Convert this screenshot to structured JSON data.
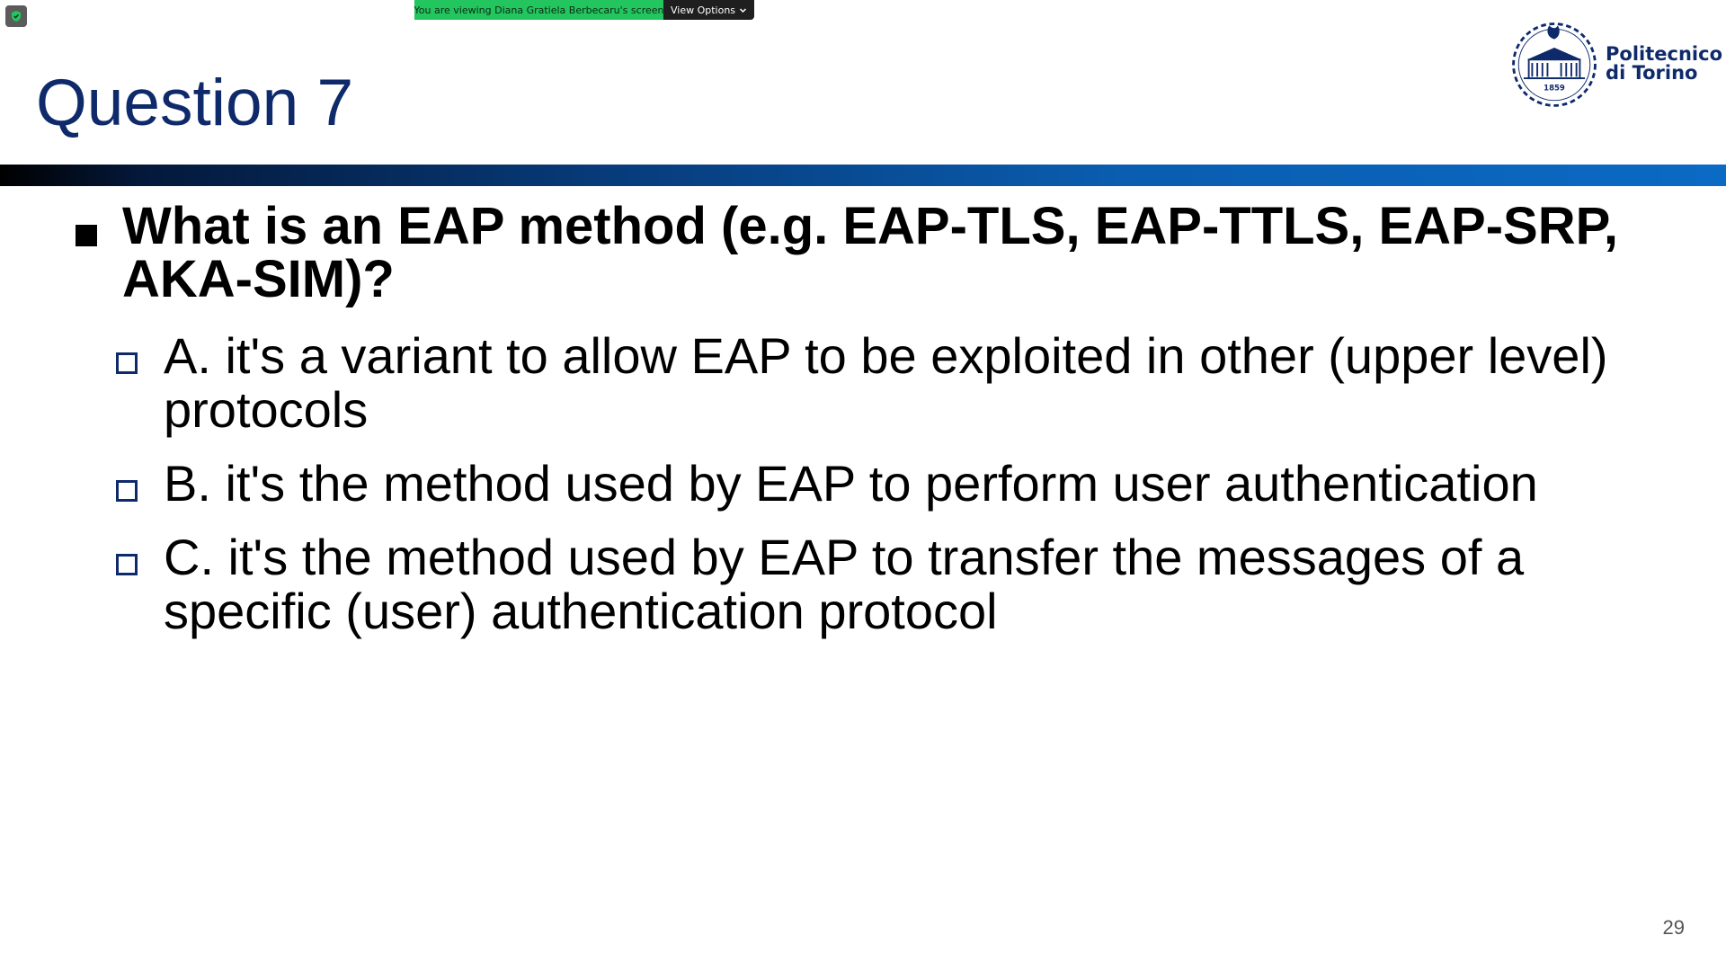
{
  "zoom": {
    "viewing_text": "You are viewing Diana Gratiela Berbecaru's screen",
    "view_options_label": "View Options",
    "shield_icon": "shield-icon",
    "chevron_icon": "chevron-down-icon"
  },
  "slide": {
    "title": "Question 7",
    "logo": {
      "line1": "Politecnico",
      "line2": "di Torino",
      "year": "1859"
    },
    "question": "What is an EAP method (e.g. EAP-TLS, EAP-TTLS, EAP-SRP, AKA-SIM)?",
    "options": [
      {
        "text": "A. it's a variant to allow EAP to be exploited in other (upper level) protocols"
      },
      {
        "text": "B. it's the method used by EAP to perform user authentication"
      },
      {
        "text": "C. it's the method used by EAP to transfer the messages of a specific (user) authentication protocol"
      }
    ],
    "page_number": "29"
  },
  "colors": {
    "title": "#0f2a6b",
    "banner_green": "#22c55e",
    "banner_dark": "#1f1f1f",
    "bar_start": "#000000",
    "bar_end": "#0b6ac4"
  }
}
